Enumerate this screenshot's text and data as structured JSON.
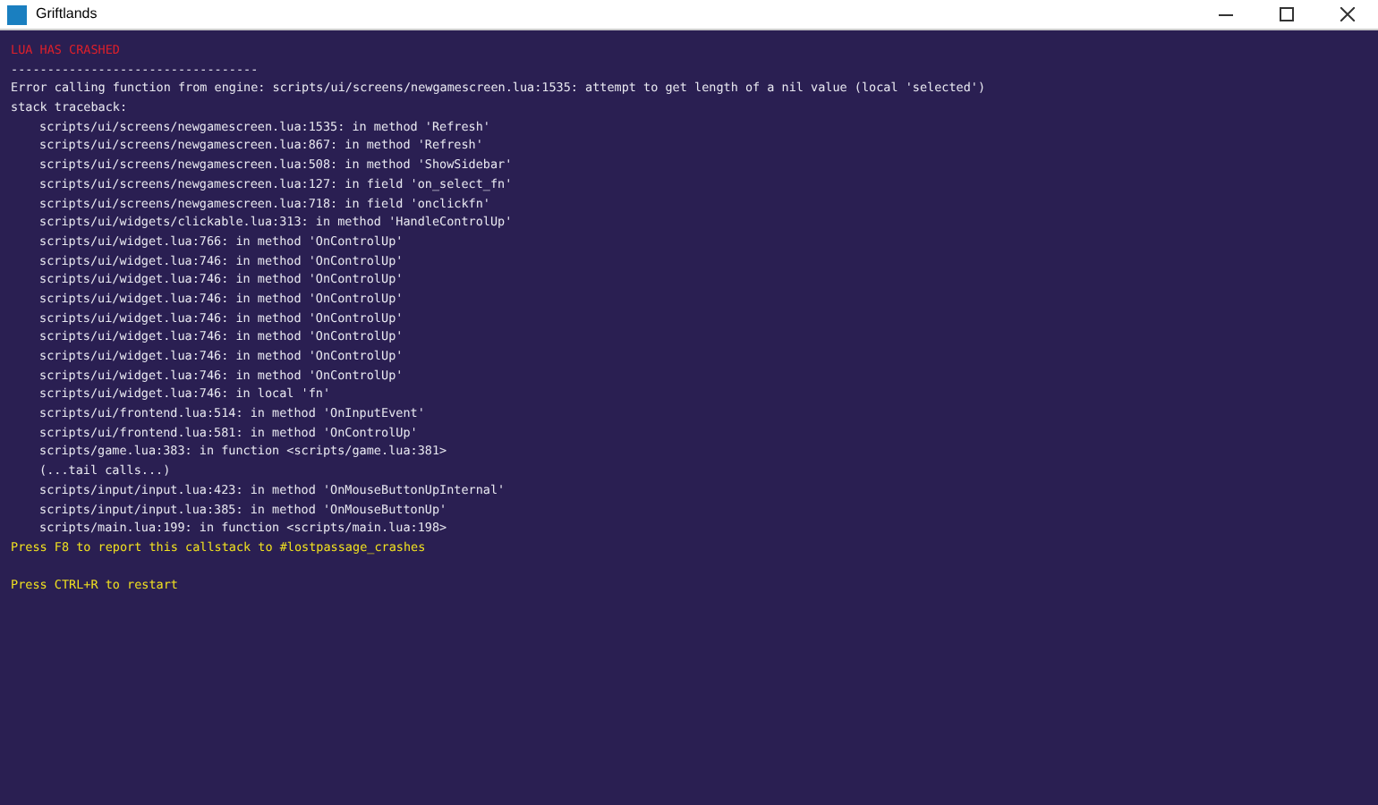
{
  "window": {
    "title": "Griftlands"
  },
  "console": {
    "header": "LUA HAS CRASHED",
    "separator": "----------------------------------",
    "error": "Error calling function from engine: scripts/ui/screens/newgamescreen.lua:1535: attempt to get length of a nil value (local 'selected')",
    "traceback_label": "stack traceback:",
    "frames": [
      "scripts/ui/screens/newgamescreen.lua:1535: in method 'Refresh'",
      "scripts/ui/screens/newgamescreen.lua:867: in method 'Refresh'",
      "scripts/ui/screens/newgamescreen.lua:508: in method 'ShowSidebar'",
      "scripts/ui/screens/newgamescreen.lua:127: in field 'on_select_fn'",
      "scripts/ui/screens/newgamescreen.lua:718: in field 'onclickfn'",
      "scripts/ui/widgets/clickable.lua:313: in method 'HandleControlUp'",
      "scripts/ui/widget.lua:766: in method 'OnControlUp'",
      "scripts/ui/widget.lua:746: in method 'OnControlUp'",
      "scripts/ui/widget.lua:746: in method 'OnControlUp'",
      "scripts/ui/widget.lua:746: in method 'OnControlUp'",
      "scripts/ui/widget.lua:746: in method 'OnControlUp'",
      "scripts/ui/widget.lua:746: in method 'OnControlUp'",
      "scripts/ui/widget.lua:746: in method 'OnControlUp'",
      "scripts/ui/widget.lua:746: in method 'OnControlUp'",
      "scripts/ui/widget.lua:746: in local 'fn'",
      "scripts/ui/frontend.lua:514: in method 'OnInputEvent'",
      "scripts/ui/frontend.lua:581: in method 'OnControlUp'",
      "scripts/game.lua:383: in function <scripts/game.lua:381>",
      "(...tail calls...)",
      "scripts/input/input.lua:423: in method 'OnMouseButtonUpInternal'",
      "scripts/input/input.lua:385: in method 'OnMouseButtonUp'",
      "scripts/main.lua:199: in function <scripts/main.lua:198>"
    ],
    "report_hint": "Press F8 to report this callstack to #lostpassage_crashes",
    "restart_hint": "Press CTRL+R to restart"
  }
}
